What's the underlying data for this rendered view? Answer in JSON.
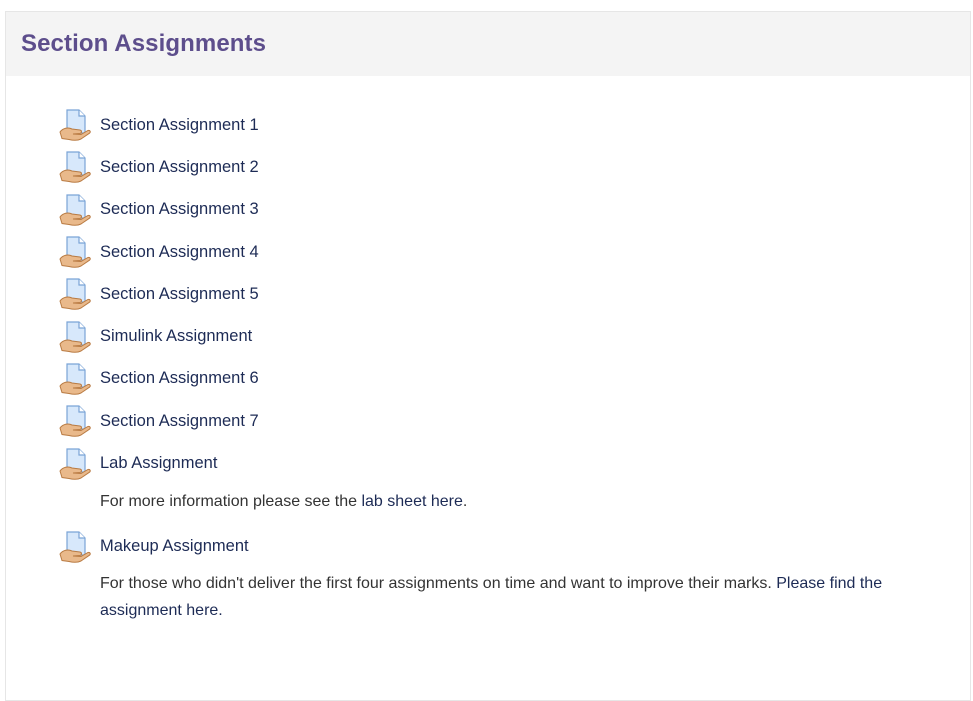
{
  "section": {
    "title": "Section Assignments"
  },
  "assignments": [
    {
      "label": "Section Assignment 1",
      "icon": "assignment-icon"
    },
    {
      "label": "Section Assignment 2",
      "icon": "assignment-icon"
    },
    {
      "label": "Section Assignment 3",
      "icon": "assignment-icon"
    },
    {
      "label": "Section Assignment 4",
      "icon": "assignment-icon"
    },
    {
      "label": "Section Assignment 5",
      "icon": "assignment-icon"
    },
    {
      "label": "Simulink Assignment",
      "icon": "assignment-icon"
    },
    {
      "label": "Section Assignment 6",
      "icon": "assignment-icon"
    },
    {
      "label": "Section Assignment 7",
      "icon": "assignment-icon"
    },
    {
      "label": "Lab Assignment",
      "icon": "assignment-icon",
      "description": {
        "text_before": "For more information please see the ",
        "link_text": "lab sheet here",
        "text_after": "."
      }
    },
    {
      "label": "Makeup Assignment",
      "icon": "assignment-icon",
      "description": {
        "text_before": "For those who didn't deliver the first four assignments on time and want to improve their marks. ",
        "link_text": "Please find the assignment here."
      }
    }
  ],
  "colors": {
    "title": "#5d4e8c",
    "link": "#1d2b55",
    "text": "#333333",
    "header_bg": "#f4f4f4"
  }
}
